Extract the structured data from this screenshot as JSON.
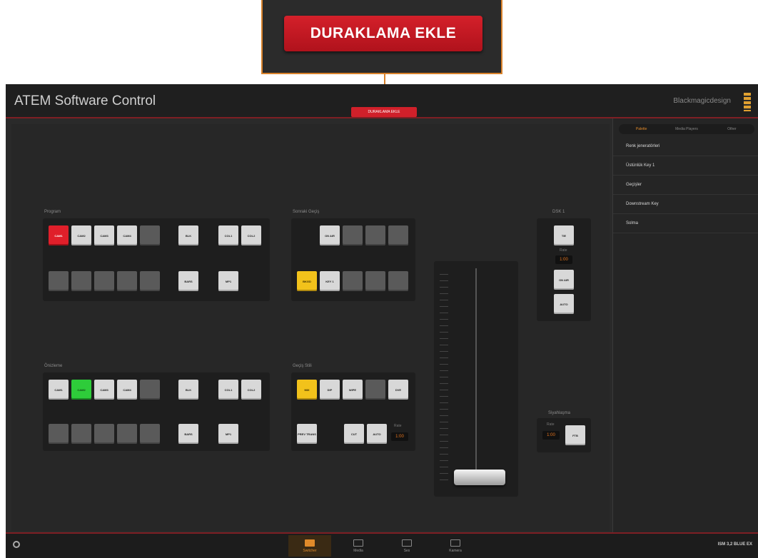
{
  "callout": {
    "label": "DURAKLAMA EKLE"
  },
  "window": {
    "title": "ATEM Software Control",
    "brand": "Blackmagicdesign",
    "pause_small": "DURAKLAMA EKLE"
  },
  "sidepanel": {
    "tabs": [
      "Palette",
      "Media Players",
      "Other"
    ],
    "active_tab": 0,
    "rows": [
      "Renk jeneratörleri",
      "Üstünlük Key 1",
      "Geçişler",
      "Downstream Key",
      "Solma"
    ]
  },
  "program": {
    "label": "Program",
    "row1": [
      "CAM1",
      "CAM2",
      "CAM3",
      "CAM4",
      "",
      "BLK",
      "COL1",
      "COL2"
    ],
    "row2": [
      "",
      "",
      "",
      "",
      "",
      "BARS",
      "MP1"
    ]
  },
  "preview": {
    "label": "Önizleme",
    "row1": [
      "CAM1",
      "CAM2",
      "CAM3",
      "CAM4",
      "",
      "BLK",
      "COL1",
      "COL2"
    ],
    "row2": [
      "",
      "",
      "",
      "",
      "",
      "BARS",
      "MP1"
    ]
  },
  "next_transition": {
    "label": "Sonraki Geçiş",
    "row1": [
      "ON AIR",
      "",
      "",
      ""
    ],
    "row2": [
      "BKGD",
      "KEY 1",
      "",
      "",
      ""
    ]
  },
  "transition_style": {
    "label": "Geçiş Stili",
    "row1": [
      "MIX",
      "DIP",
      "WIPE",
      "",
      "DVE"
    ],
    "row2": [
      "PREV TRANS",
      "CUT",
      "AUTO"
    ],
    "rate_label": "Rate",
    "rate": "1:00"
  },
  "dsk": {
    "label": "DSK 1",
    "buttons": [
      "TIE",
      "ON AIR",
      "AUTO"
    ],
    "rate_label": "Rate",
    "rate": "1:00"
  },
  "fade_to_black": {
    "label": "Siyahlaşma",
    "rate_label": "Rate",
    "rate": "1:00",
    "button": "FTB"
  },
  "bottom_nav": [
    "Switcher",
    "Media",
    "Ses",
    "Kamera"
  ],
  "bottom_nav_active": 0,
  "status_right": "ISM 3,2 BLUE EX"
}
